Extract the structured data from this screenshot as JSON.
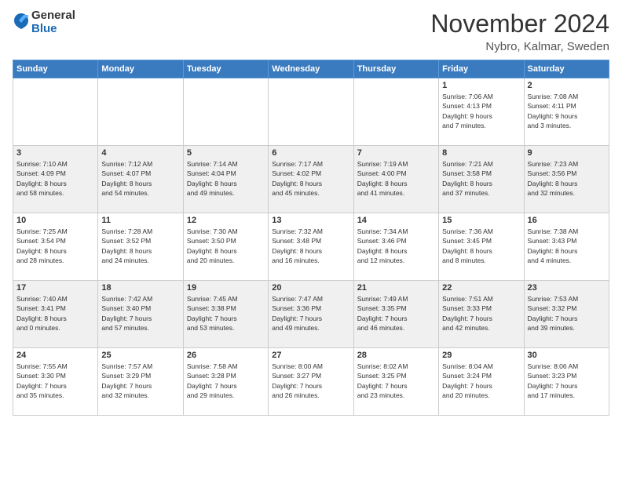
{
  "header": {
    "logo_general": "General",
    "logo_blue": "Blue",
    "month_title": "November 2024",
    "location": "Nybro, Kalmar, Sweden"
  },
  "weekdays": [
    "Sunday",
    "Monday",
    "Tuesday",
    "Wednesday",
    "Thursday",
    "Friday",
    "Saturday"
  ],
  "weeks": [
    [
      {
        "day": "",
        "info": ""
      },
      {
        "day": "",
        "info": ""
      },
      {
        "day": "",
        "info": ""
      },
      {
        "day": "",
        "info": ""
      },
      {
        "day": "",
        "info": ""
      },
      {
        "day": "1",
        "info": "Sunrise: 7:06 AM\nSunset: 4:13 PM\nDaylight: 9 hours\nand 7 minutes."
      },
      {
        "day": "2",
        "info": "Sunrise: 7:08 AM\nSunset: 4:11 PM\nDaylight: 9 hours\nand 3 minutes."
      }
    ],
    [
      {
        "day": "3",
        "info": "Sunrise: 7:10 AM\nSunset: 4:09 PM\nDaylight: 8 hours\nand 58 minutes."
      },
      {
        "day": "4",
        "info": "Sunrise: 7:12 AM\nSunset: 4:07 PM\nDaylight: 8 hours\nand 54 minutes."
      },
      {
        "day": "5",
        "info": "Sunrise: 7:14 AM\nSunset: 4:04 PM\nDaylight: 8 hours\nand 49 minutes."
      },
      {
        "day": "6",
        "info": "Sunrise: 7:17 AM\nSunset: 4:02 PM\nDaylight: 8 hours\nand 45 minutes."
      },
      {
        "day": "7",
        "info": "Sunrise: 7:19 AM\nSunset: 4:00 PM\nDaylight: 8 hours\nand 41 minutes."
      },
      {
        "day": "8",
        "info": "Sunrise: 7:21 AM\nSunset: 3:58 PM\nDaylight: 8 hours\nand 37 minutes."
      },
      {
        "day": "9",
        "info": "Sunrise: 7:23 AM\nSunset: 3:56 PM\nDaylight: 8 hours\nand 32 minutes."
      }
    ],
    [
      {
        "day": "10",
        "info": "Sunrise: 7:25 AM\nSunset: 3:54 PM\nDaylight: 8 hours\nand 28 minutes."
      },
      {
        "day": "11",
        "info": "Sunrise: 7:28 AM\nSunset: 3:52 PM\nDaylight: 8 hours\nand 24 minutes."
      },
      {
        "day": "12",
        "info": "Sunrise: 7:30 AM\nSunset: 3:50 PM\nDaylight: 8 hours\nand 20 minutes."
      },
      {
        "day": "13",
        "info": "Sunrise: 7:32 AM\nSunset: 3:48 PM\nDaylight: 8 hours\nand 16 minutes."
      },
      {
        "day": "14",
        "info": "Sunrise: 7:34 AM\nSunset: 3:46 PM\nDaylight: 8 hours\nand 12 minutes."
      },
      {
        "day": "15",
        "info": "Sunrise: 7:36 AM\nSunset: 3:45 PM\nDaylight: 8 hours\nand 8 minutes."
      },
      {
        "day": "16",
        "info": "Sunrise: 7:38 AM\nSunset: 3:43 PM\nDaylight: 8 hours\nand 4 minutes."
      }
    ],
    [
      {
        "day": "17",
        "info": "Sunrise: 7:40 AM\nSunset: 3:41 PM\nDaylight: 8 hours\nand 0 minutes."
      },
      {
        "day": "18",
        "info": "Sunrise: 7:42 AM\nSunset: 3:40 PM\nDaylight: 7 hours\nand 57 minutes."
      },
      {
        "day": "19",
        "info": "Sunrise: 7:45 AM\nSunset: 3:38 PM\nDaylight: 7 hours\nand 53 minutes."
      },
      {
        "day": "20",
        "info": "Sunrise: 7:47 AM\nSunset: 3:36 PM\nDaylight: 7 hours\nand 49 minutes."
      },
      {
        "day": "21",
        "info": "Sunrise: 7:49 AM\nSunset: 3:35 PM\nDaylight: 7 hours\nand 46 minutes."
      },
      {
        "day": "22",
        "info": "Sunrise: 7:51 AM\nSunset: 3:33 PM\nDaylight: 7 hours\nand 42 minutes."
      },
      {
        "day": "23",
        "info": "Sunrise: 7:53 AM\nSunset: 3:32 PM\nDaylight: 7 hours\nand 39 minutes."
      }
    ],
    [
      {
        "day": "24",
        "info": "Sunrise: 7:55 AM\nSunset: 3:30 PM\nDaylight: 7 hours\nand 35 minutes."
      },
      {
        "day": "25",
        "info": "Sunrise: 7:57 AM\nSunset: 3:29 PM\nDaylight: 7 hours\nand 32 minutes."
      },
      {
        "day": "26",
        "info": "Sunrise: 7:58 AM\nSunset: 3:28 PM\nDaylight: 7 hours\nand 29 minutes."
      },
      {
        "day": "27",
        "info": "Sunrise: 8:00 AM\nSunset: 3:27 PM\nDaylight: 7 hours\nand 26 minutes."
      },
      {
        "day": "28",
        "info": "Sunrise: 8:02 AM\nSunset: 3:25 PM\nDaylight: 7 hours\nand 23 minutes."
      },
      {
        "day": "29",
        "info": "Sunrise: 8:04 AM\nSunset: 3:24 PM\nDaylight: 7 hours\nand 20 minutes."
      },
      {
        "day": "30",
        "info": "Sunrise: 8:06 AM\nSunset: 3:23 PM\nDaylight: 7 hours\nand 17 minutes."
      }
    ]
  ]
}
